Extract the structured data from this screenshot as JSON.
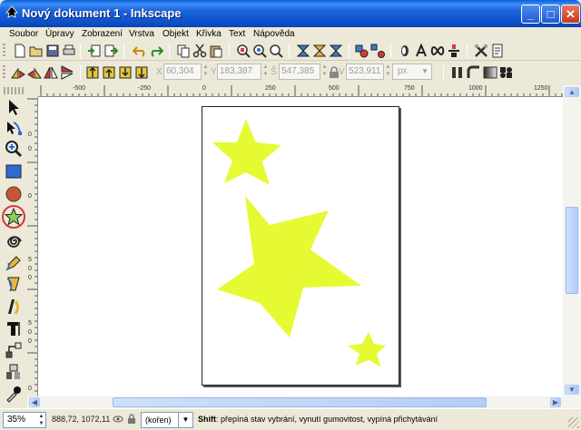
{
  "window": {
    "title": "Nový dokument 1 - Inkscape",
    "controls": {
      "minimize": "_",
      "maximize": "□",
      "close": "✕"
    }
  },
  "menu": [
    "Soubor",
    "Úpravy",
    "Zobrazení",
    "Vrstva",
    "Objekt",
    "Křivka",
    "Text",
    "Nápověda"
  ],
  "toolbar_commands": [
    "new-icon",
    "open-icon",
    "save-icon",
    "print-icon",
    "import-icon",
    "export-icon",
    "undo-icon",
    "redo-icon",
    "copy-icon",
    "cut-icon",
    "paste-icon",
    "zoom-selection-icon",
    "zoom-drawing-icon",
    "zoom-page-icon",
    "duplicate-icon",
    "clone-icon",
    "unlink-icon",
    "group-icon",
    "ungroup-icon",
    "fill-stroke-icon",
    "text-font-icon",
    "xml-editor-icon",
    "align-icon",
    "preferences-icon"
  ],
  "select_toolbar": {
    "x_label": "X",
    "x_value": "60,304",
    "y_label": "Y",
    "y_value": "183,387",
    "w_label": "Š",
    "w_value": "547,385",
    "h_label": "V",
    "h_value": "523,911",
    "unit": "px"
  },
  "rulers": {
    "horizontal": [
      "-500",
      "-250",
      "0",
      "250",
      "500",
      "750",
      "1000",
      "1250"
    ],
    "vertical": [
      "0",
      "0",
      "0",
      "5",
      "0",
      "0",
      "5",
      "0",
      "0",
      "0"
    ]
  },
  "tools": [
    "selector-tool-icon",
    "node-tool-icon",
    "zoom-tool-icon",
    "rectangle-tool-icon",
    "ellipse-tool-icon",
    "star-tool-icon",
    "spiral-tool-icon",
    "pencil-tool-icon",
    "pen-tool-icon",
    "calligraphy-tool-icon",
    "text-tool-icon",
    "connector-tool-icon",
    "gradient-tool-icon",
    "dropper-tool-icon"
  ],
  "active_tool": "star-tool-icon",
  "star_color": "#e6fa34",
  "status": {
    "zoom": "35%",
    "coords": "888,72, 1072,11",
    "layer": "(kořen)",
    "message_key": "Shift",
    "message_text": ": přepíná stav vybrání, vynutí gumovitost, vypíná přichytávání"
  }
}
